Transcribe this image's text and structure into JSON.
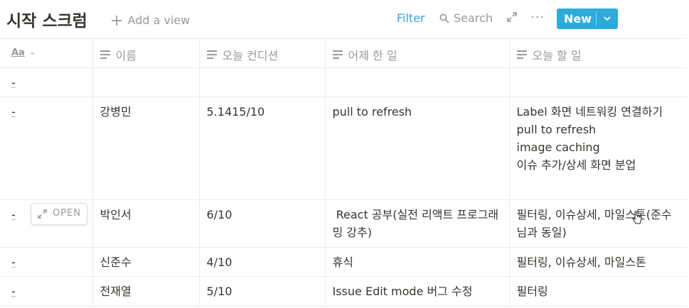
{
  "header": {
    "title": "시작 스크럼",
    "add_view": "Add a view",
    "filter": "Filter",
    "search": "Search",
    "more": "···",
    "new_label": "New",
    "accent_color": "#2eaadc"
  },
  "table": {
    "columns": [
      {
        "label": "-",
        "icon": "title-aa-icon"
      },
      {
        "label": "이름",
        "icon": "text-lines-icon"
      },
      {
        "label": "오늘 컨디션",
        "icon": "text-lines-icon"
      },
      {
        "label": "어제 한 일",
        "icon": "text-lines-icon"
      },
      {
        "label": "오늘 할 일",
        "icon": "text-lines-icon"
      }
    ],
    "rows": [
      {
        "title": "-",
        "name": "",
        "condition": "",
        "yesterday": [],
        "today": []
      },
      {
        "title": "-",
        "name": "강병민",
        "condition": "5.1415/10",
        "yesterday": [
          "pull to refresh"
        ],
        "today": [
          "Label 화면 네트워킹 연결하기",
          "pull to refresh",
          "image caching",
          "이슈 추가/상세 화면 분업"
        ]
      },
      {
        "title": "-",
        "name": "박인서",
        "condition": "6/10",
        "yesterday": [
          " React 공부(실전 리액트 프로그래밍 강추)"
        ],
        "today": [
          "필터링, 이슈상세, 마일스톤(준수님과 동일)"
        ]
      },
      {
        "title": "-",
        "name": "신준수",
        "condition": "4/10",
        "yesterday": [
          "휴식"
        ],
        "today": [
          "필터링, 이슈상세, 마일스톤"
        ]
      },
      {
        "title": "-",
        "name": "전재열",
        "condition": "5/10",
        "yesterday": [
          "Issue Edit mode 버그 수정"
        ],
        "today": [
          "필터링"
        ]
      }
    ],
    "open_label": "OPEN"
  }
}
